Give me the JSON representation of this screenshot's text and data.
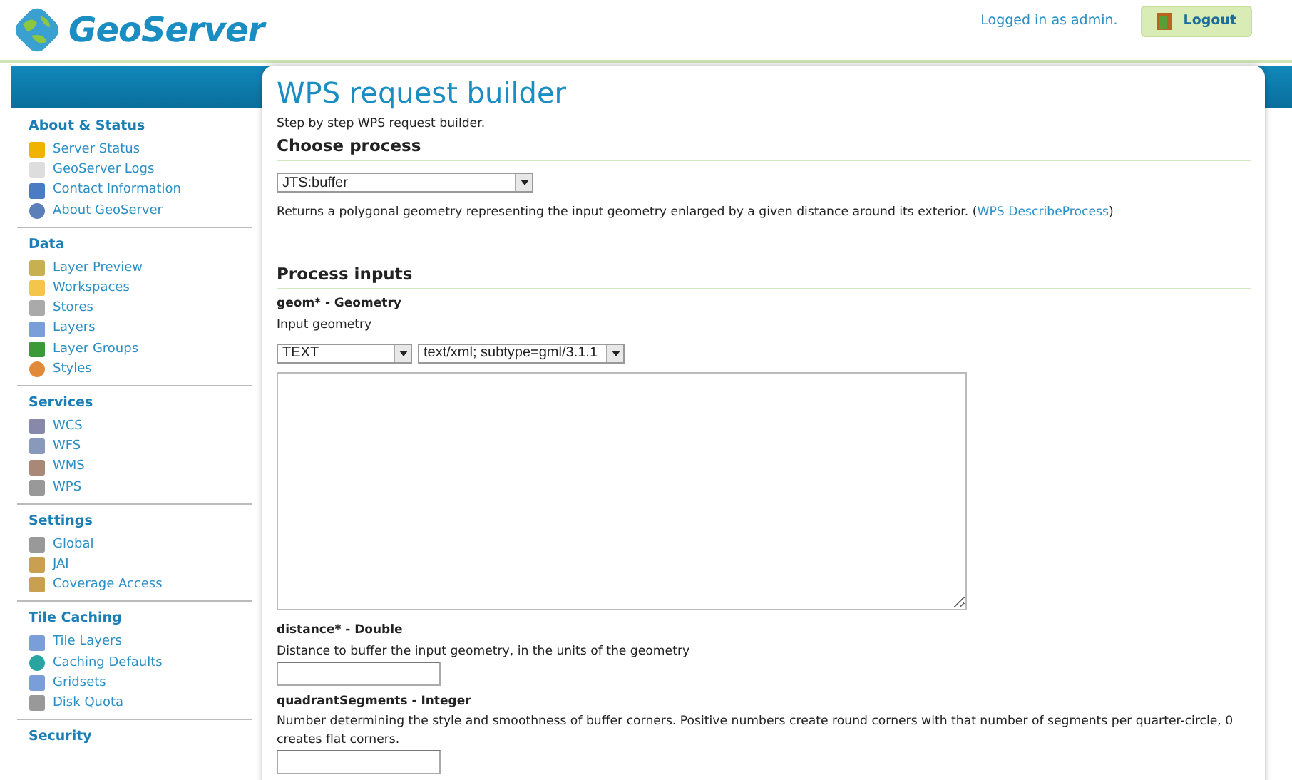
{
  "header": {
    "logo_text": "GeoServer",
    "login_status": "Logged in as admin.",
    "logout_button": "Logout"
  },
  "sidebar": {
    "sections": [
      {
        "title": "About & Status",
        "items": [
          "Server Status",
          "GeoServer Logs",
          "Contact Information",
          "About GeoServer"
        ]
      },
      {
        "title": "Data",
        "items": [
          "Layer Preview",
          "Workspaces",
          "Stores",
          "Layers",
          "Layer Groups",
          "Styles"
        ]
      },
      {
        "title": "Services",
        "items": [
          "WCS",
          "WFS",
          "WMS",
          "WPS"
        ]
      },
      {
        "title": "Settings",
        "items": [
          "Global",
          "JAI",
          "Coverage Access"
        ]
      },
      {
        "title": "Tile Caching",
        "items": [
          "Tile Layers",
          "Caching Defaults",
          "Gridsets",
          "Disk Quota"
        ]
      },
      {
        "title": "Security"
      }
    ]
  },
  "page": {
    "title": "WPS request builder",
    "subtitle": "Step by step WPS request builder.",
    "choose_process": {
      "heading": "Choose process",
      "selected_process": "JTS:buffer",
      "description": "Returns a polygonal geometry representing the input geometry enlarged by a given distance around its exterior. (",
      "link": "WPS DescribeProcess",
      "description_end": ")"
    },
    "process_inputs": {
      "heading": "Process inputs",
      "inputs": [
        {
          "kind": "geometry",
          "label": "geom* - Geometry",
          "description": "Input geometry",
          "type_select": "TEXT",
          "format_select": "text/xml; subtype=gml/3.1.1"
        },
        {
          "kind": "field",
          "label": "distance* - Double",
          "description": "Distance to buffer the input geometry, in the units of the geometry"
        },
        {
          "kind": "field",
          "label": "quadrantSegments - Integer",
          "description": "Number determining the style and smoothness of buffer corners. Positive numbers create round corners with that number of segments per quarter-circle, 0 creates flat corners."
        }
      ]
    }
  }
}
